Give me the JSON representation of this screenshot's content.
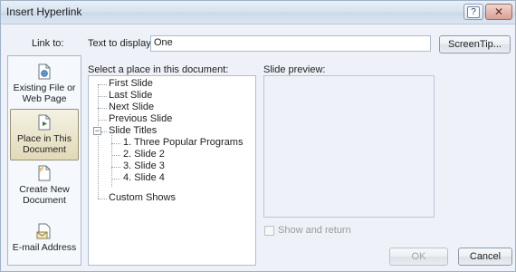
{
  "window": {
    "title": "Insert Hyperlink"
  },
  "header": {
    "link_to_label": "Link to:",
    "text_to_display_label": "Text to display:",
    "text_to_display_value": "One",
    "screentip_label": "ScreenTip..."
  },
  "sidebar": {
    "items": [
      {
        "label_line1": "Existing File or",
        "label_line2": "Web Page",
        "icon": "existing-file-web-page-icon"
      },
      {
        "label_line1": "Place in This",
        "label_line2": "Document",
        "icon": "place-in-document-icon",
        "selected": true
      },
      {
        "label_line1": "Create New",
        "label_line2": "Document",
        "icon": "create-new-document-icon"
      },
      {
        "label_line1": "E-mail Address",
        "label_line2": "",
        "icon": "email-address-icon"
      }
    ]
  },
  "places": {
    "label": "Select a place in this document:",
    "tree": [
      "First Slide",
      "Last Slide",
      "Next Slide",
      "Previous Slide",
      "Slide Titles",
      "1. Three Popular Programs",
      "2. Slide 2",
      "3. Slide 3",
      "4. Slide 4",
      "Custom Shows"
    ],
    "expander_symbol": "−"
  },
  "preview": {
    "label": "Slide preview:",
    "show_and_return_label": "Show and return"
  },
  "footer": {
    "ok_label": "OK",
    "cancel_label": "Cancel"
  },
  "window_controls": {
    "help_label": "?",
    "close_label": "✕"
  }
}
